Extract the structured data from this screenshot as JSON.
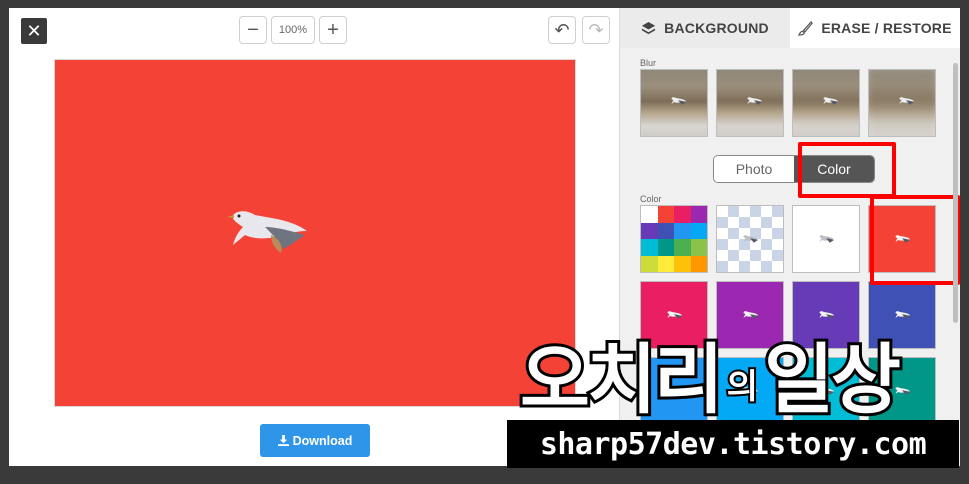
{
  "toolbar": {
    "close_glyph": "✕",
    "zoom_out_glyph": "−",
    "zoom_value": "100%",
    "zoom_in_glyph": "+",
    "undo_glyph": "↶",
    "redo_glyph": "↷"
  },
  "canvas": {
    "background_color": "#f44336"
  },
  "download": {
    "label": "Download",
    "icon": "download-icon"
  },
  "panel": {
    "tabs": [
      {
        "label": "BACKGROUND",
        "icon": "layers-icon",
        "active": true
      },
      {
        "label": "ERASE / RESTORE",
        "icon": "brush-icon",
        "active": false
      }
    ],
    "blur_label": "Blur",
    "blur_levels": 4,
    "mode_toggle": {
      "photo": "Photo",
      "color": "Color",
      "selected": "Color"
    },
    "color_label": "Color",
    "color_swatches": [
      "palette",
      "transparent",
      "#ffffff",
      "#f44336",
      "#e91e63",
      "#9c27b0",
      "#673ab7",
      "#3f51b5",
      "#2196f3",
      "#03a9f4",
      "#00bcd4",
      "#009688"
    ],
    "selected_color": "#f44336",
    "palette_colors": [
      "#ffffff",
      "#f44336",
      "#e91e63",
      "#9c27b0",
      "#673ab7",
      "#3f51b5",
      "#2196f3",
      "#03a9f4",
      "#00bcd4",
      "#009688",
      "#4caf50",
      "#8bc34a",
      "#cddc39",
      "#ffeb3b",
      "#ffc107",
      "#ff9800"
    ]
  },
  "watermark": {
    "title_part1": "오치리",
    "title_small": "의",
    "title_part2": "일상",
    "url": "sharp57dev.tistory.com"
  }
}
